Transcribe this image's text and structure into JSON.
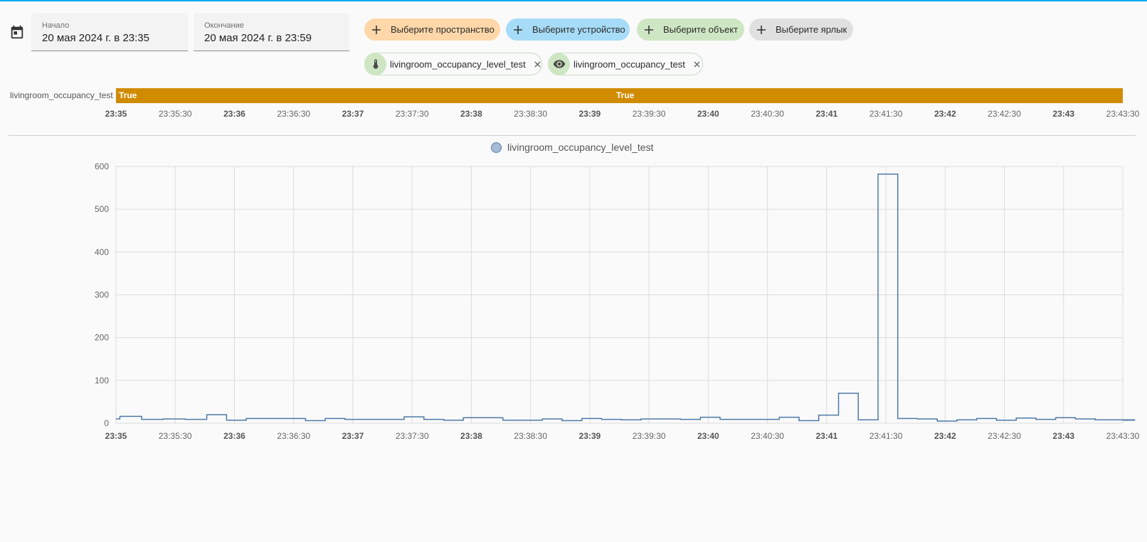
{
  "date_picker": {
    "icon": "calendar-icon",
    "start_label": "Начало",
    "start_value": "20 мая 2024 г. в 23:35",
    "end_label": "Окончание",
    "end_value": "20 мая 2024 г. в 23:59"
  },
  "target_chips": [
    {
      "name": "chip-select-area",
      "label": "Выберите пространство",
      "color": "#ffd7a8"
    },
    {
      "name": "chip-select-device",
      "label": "Выберите устройство",
      "color": "#a6dcf7"
    },
    {
      "name": "chip-select-entity",
      "label": "Выберите объект",
      "color": "#cfe6c4"
    },
    {
      "name": "chip-select-label",
      "label": "Выберите ярлык",
      "color": "#e0e0e0"
    }
  ],
  "selected_entities": [
    {
      "label": "livingroom_occupancy_level_test",
      "icon": "thermometer-icon"
    },
    {
      "label": "livingroom_occupancy_test",
      "icon": "eye-icon"
    }
  ],
  "timeline": {
    "entity": "livingroom_occupancy_test",
    "states": [
      "True",
      "True"
    ],
    "bar_color": "#d08b00"
  },
  "time_ticks": [
    "23:35",
    "23:35:30",
    "23:36",
    "23:36:30",
    "23:37",
    "23:37:30",
    "23:38",
    "23:38:30",
    "23:39",
    "23:39:30",
    "23:40",
    "23:40:30",
    "23:41",
    "23:41:30",
    "23:42",
    "23:42:30",
    "23:43",
    "23:43:30"
  ],
  "major_ticks": [
    "23:35",
    "23:36",
    "23:37",
    "23:38",
    "23:39",
    "23:40",
    "23:41",
    "23:42",
    "23:43"
  ],
  "chart_data": {
    "type": "line",
    "step": true,
    "series": [
      {
        "name": "livingroom_occupancy_level_test",
        "color": "#4e79a7",
        "x": [
          "23:35:00",
          "23:35:02",
          "23:35:13",
          "23:35:24",
          "23:35:35",
          "23:35:46",
          "23:35:56",
          "23:36:06",
          "23:36:16",
          "23:36:26",
          "23:36:36",
          "23:36:46",
          "23:36:56",
          "23:37:06",
          "23:37:16",
          "23:37:26",
          "23:37:36",
          "23:37:46",
          "23:37:56",
          "23:38:06",
          "23:38:16",
          "23:38:26",
          "23:38:36",
          "23:38:46",
          "23:38:56",
          "23:39:06",
          "23:39:16",
          "23:39:26",
          "23:39:36",
          "23:39:46",
          "23:39:56",
          "23:40:06",
          "23:40:16",
          "23:40:26",
          "23:40:36",
          "23:40:46",
          "23:40:56",
          "23:41:06",
          "23:41:16",
          "23:41:26",
          "23:41:36",
          "23:41:46",
          "23:41:56",
          "23:42:06",
          "23:42:16",
          "23:42:26",
          "23:42:36",
          "23:42:46",
          "23:42:56",
          "23:43:06",
          "23:43:16",
          "23:43:26",
          "23:43:36"
        ],
        "y": [
          10,
          16,
          9,
          10,
          9,
          20,
          7,
          11,
          11,
          11,
          6,
          11,
          9,
          9,
          9,
          15,
          9,
          7,
          13,
          13,
          7,
          7,
          10,
          6,
          11,
          9,
          8,
          10,
          10,
          9,
          14,
          9,
          9,
          9,
          14,
          6,
          19,
          70,
          8,
          582,
          11,
          10,
          5,
          8,
          11,
          7,
          12,
          9,
          13,
          10,
          8,
          8,
          7
        ]
      }
    ],
    "ylim": [
      0,
      600
    ],
    "yticks": [
      0,
      100,
      200,
      300,
      400,
      500,
      600
    ],
    "xlim": [
      "23:35:00",
      "23:43:30"
    ],
    "grid": true,
    "legend": "top-center"
  }
}
